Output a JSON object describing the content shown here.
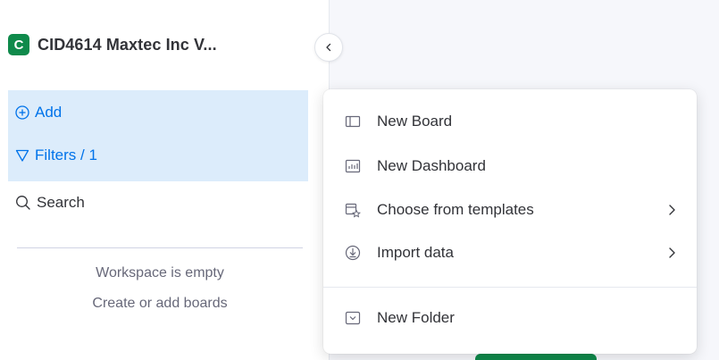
{
  "sidebar": {
    "workspace": {
      "badge": "C",
      "title": "CID4614 Maxtec Inc V..."
    },
    "actions": {
      "add": "Add",
      "filters": "Filters / 1"
    },
    "search": "Search",
    "empty_state": {
      "line1": "Workspace is empty",
      "line2": "Create or add boards"
    }
  },
  "menu": {
    "items": [
      {
        "label": "New Board",
        "icon": "board-icon",
        "has_submenu": false
      },
      {
        "label": "New Dashboard",
        "icon": "dashboard-icon",
        "has_submenu": false
      },
      {
        "label": "Choose from templates",
        "icon": "templates-icon",
        "has_submenu": true
      },
      {
        "label": "Import data",
        "icon": "import-icon",
        "has_submenu": true
      },
      {
        "label": "New Folder",
        "icon": "folder-icon",
        "has_submenu": false
      }
    ]
  },
  "colors": {
    "brand_green": "#0f8a4b",
    "accent_blue": "#0073ea",
    "selected_bg": "#dcecfb",
    "text_primary": "#323338",
    "text_secondary": "#676879"
  }
}
